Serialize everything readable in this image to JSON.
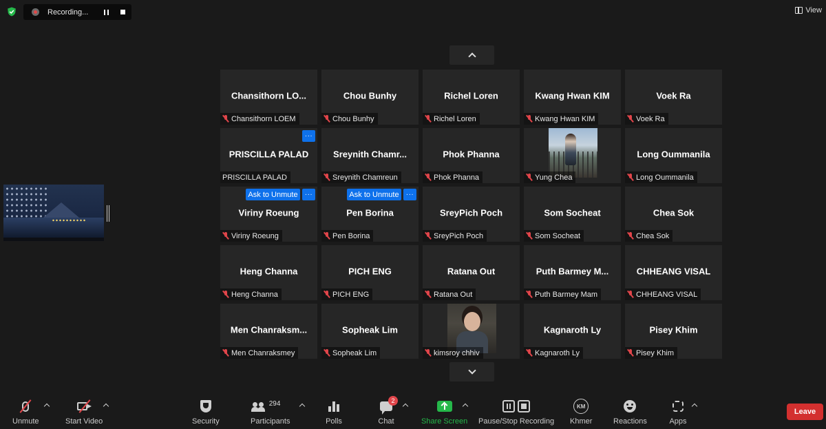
{
  "top_bar": {
    "recording_label": "Recording...",
    "view_label": "View"
  },
  "gallery": [
    [
      {
        "display": "Chansithorn LO...",
        "name": "Chansithorn LOEM",
        "muted": true
      },
      {
        "display": "Chou Bunhy",
        "name": "Chou Bunhy",
        "muted": true
      },
      {
        "display": "Richel Loren",
        "name": "Richel Loren",
        "muted": true
      },
      {
        "display": "Kwang Hwan KIM",
        "name": "Kwang Hwan KIM",
        "muted": true
      },
      {
        "display": "Voek Ra",
        "name": "Voek Ra",
        "muted": true
      }
    ],
    [
      {
        "display": "PRISCILLA PALAD",
        "name": "PRISCILLA PALAD",
        "muted": false,
        "more_menu": true
      },
      {
        "display": "Sreynith Chamr...",
        "name": "Sreynith Chamreun",
        "muted": true
      },
      {
        "display": "Phok Phanna",
        "name": "Phok Phanna",
        "muted": true
      },
      {
        "display": "",
        "name": "Yung Chea",
        "muted": true,
        "video": "vid-yung"
      },
      {
        "display": "Long Oummanila",
        "name": "Long Oummanila",
        "muted": true
      }
    ],
    [
      {
        "display": "Viriny Roeung",
        "name": "Viriny Roeung",
        "muted": true,
        "more_menu": true,
        "ask_to_unmute": "Ask to Unmute"
      },
      {
        "display": "Pen Borina",
        "name": "Pen Borina",
        "muted": true,
        "more_menu": true,
        "ask_to_unmute": "Ask to Unmute"
      },
      {
        "display": "SreyPich Poch",
        "name": "SreyPich Poch",
        "muted": true
      },
      {
        "display": "Som Socheat",
        "name": "Som Socheat",
        "muted": true
      },
      {
        "display": "Chea Sok",
        "name": "Chea Sok",
        "muted": true
      }
    ],
    [
      {
        "display": "Heng Channa",
        "name": "Heng Channa",
        "muted": true
      },
      {
        "display": "PICH ENG",
        "name": "PICH ENG",
        "muted": true
      },
      {
        "display": "Ratana Out",
        "name": "Ratana Out",
        "muted": true
      },
      {
        "display": "Puth Barmey M...",
        "name": "Puth Barmey Mam",
        "muted": true
      },
      {
        "display": "CHHEANG VISAL",
        "name": "CHHEANG VISAL",
        "muted": true
      }
    ],
    [
      {
        "display": "Men Chanraksm...",
        "name": "Men Chanraksmey",
        "muted": true
      },
      {
        "display": "Sopheak Lim",
        "name": "Sopheak Lim",
        "muted": true
      },
      {
        "display": "",
        "name": "kimsroy chhiv",
        "muted": true,
        "video": "vid-kim"
      },
      {
        "display": "Kagnaroth Ly",
        "name": "Kagnaroth Ly",
        "muted": true
      },
      {
        "display": "Pisey Khim",
        "name": "Pisey Khim",
        "muted": true
      }
    ]
  ],
  "toolbar": {
    "unmute": "Unmute",
    "start_video": "Start Video",
    "security": "Security",
    "participants": "Participants",
    "participants_count": "294",
    "polls": "Polls",
    "chat": "Chat",
    "chat_badge": "2",
    "share_screen": "Share Screen",
    "pause_stop_recording": "Pause/Stop Recording",
    "language": "Khmer",
    "language_icon_text": "KM",
    "reactions": "Reactions",
    "apps": "Apps",
    "leave": "Leave"
  },
  "colors": {
    "share_screen": "#25b84a",
    "leave": "#d3302f",
    "muted_mic": "#e0454a",
    "accent_button": "#0e71eb"
  },
  "icons": [
    "shield-check-icon",
    "record-icon",
    "pause-icon",
    "stop-icon",
    "view-icon",
    "chevron-up-icon",
    "chevron-down-icon",
    "muted-mic-icon",
    "video-off-icon",
    "security-icon",
    "participants-icon",
    "polls-icon",
    "chat-icon",
    "share-screen-icon",
    "reactions-icon",
    "apps-icon"
  ]
}
